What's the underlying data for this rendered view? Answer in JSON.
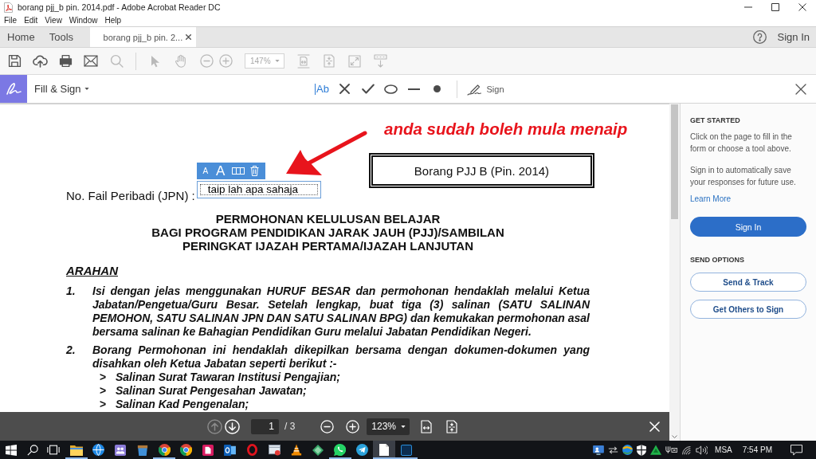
{
  "window": {
    "title": "borang pjj_b pin. 2014.pdf - Adobe Acrobat Reader DC"
  },
  "menu": [
    "File",
    "Edit",
    "View",
    "Window",
    "Help"
  ],
  "tabs": [
    {
      "label": "Home",
      "selected": false,
      "closable": false
    },
    {
      "label": "Tools",
      "selected": false,
      "closable": false
    },
    {
      "label": "borang pjj_b pin. 2...",
      "selected": true,
      "closable": true
    }
  ],
  "account": {
    "sign_in": "Sign In"
  },
  "toolbar": {
    "file_tools": [
      {
        "kind": "save",
        "disabled": false
      },
      {
        "kind": "upload",
        "disabled": false
      },
      {
        "kind": "print",
        "disabled": false
      },
      {
        "kind": "mail",
        "disabled": false
      },
      {
        "kind": "search",
        "disabled": true
      }
    ],
    "view_tools": [
      {
        "kind": "select",
        "disabled": true
      },
      {
        "kind": "hand",
        "disabled": true
      },
      {
        "kind": "zoom-out",
        "disabled": true
      },
      {
        "kind": "zoom-in",
        "disabled": true
      }
    ],
    "zoom": {
      "value": "147%",
      "disabled": true
    },
    "page_tools": [
      {
        "kind": "page-width",
        "disabled": true
      },
      {
        "kind": "fit-page",
        "disabled": true
      },
      {
        "kind": "full-screen",
        "disabled": true
      },
      {
        "kind": "read-mode",
        "disabled": true
      }
    ]
  },
  "fill_sign": {
    "title": "Fill & Sign",
    "tools": [
      {
        "kind": "text",
        "label": "Ab"
      },
      {
        "kind": "cross"
      },
      {
        "kind": "check"
      },
      {
        "kind": "ellipse"
      },
      {
        "kind": "line"
      },
      {
        "kind": "dot"
      }
    ],
    "sign": "Sign"
  },
  "document": {
    "annotation": "anda sudah boleh mula menaip",
    "form_code": "Borang PJJ B (Pin. 2014)",
    "file_label": "No. Fail Peribadi (JPN) :",
    "text_field": {
      "value": "taip lah apa sahaja",
      "toolbar": [
        {
          "kind": "smaller",
          "label": "A"
        },
        {
          "kind": "larger",
          "label": "A"
        },
        {
          "kind": "spacing"
        },
        {
          "kind": "delete"
        }
      ]
    },
    "headings": [
      "PERMOHONAN KELULUSAN BELAJAR",
      "BAGI PROGRAM PENDIDIKAN JARAK JAUH (PJJ)/SAMBILAN",
      "PERINGKAT IJAZAH PERTAMA/IJAZAH LANJUTAN"
    ],
    "section_title": "ARAHAN",
    "instructions": [
      {
        "number": "1.",
        "text": "Isi dengan jelas menggunakan HURUF BESAR dan permohonan hendaklah melalui Ketua Jabatan/Pengetua/Guru Besar. Setelah lengkap, buat tiga (3) salinan (SATU SALINAN PEMOHON, SATU SALINAN JPN DAN SATU SALINAN BPG) dan kemukakan permohonan asal bersama salinan ke Bahagian Pendidikan Guru melalui Jabatan Pendidikan Negeri."
      },
      {
        "number": "2.",
        "text": "Borang Permohonan ini hendaklah dikepilkan bersama dengan dokumen-dokumen yang disahkan oleh Ketua Jabatan seperti berikut :-",
        "items": [
          {
            "marker": ">",
            "text": "Salinan Surat Tawaran Institusi Pengajian;"
          },
          {
            "marker": ">",
            "text": "Salinan Surat Pengesahan Jawatan;"
          },
          {
            "marker": ">",
            "text": "Salinan Kad Pengenalan;"
          }
        ]
      }
    ]
  },
  "page_nav": {
    "previous": {
      "disabled": true
    },
    "next": {
      "disabled": false
    },
    "page": "1",
    "total": "/ 3",
    "zoom": "123%"
  },
  "side_panel": {
    "get_started": {
      "title": "GET STARTED",
      "paragraphs": [
        "Click on the page to fill in the form or choose a tool above.",
        "Sign in to automatically save your responses for future use."
      ],
      "link": "Learn More",
      "button": "Sign In"
    },
    "send_options": {
      "title": "SEND OPTIONS",
      "buttons": [
        "Send & Track",
        "Get Others to Sign"
      ]
    }
  },
  "taskbar": {
    "apps": [
      {
        "kind": "folder",
        "running": true,
        "active": false
      },
      {
        "kind": "globe",
        "running": false,
        "active": false
      },
      {
        "kind": "tile-people",
        "running": false,
        "active": false
      },
      {
        "kind": "cup",
        "running": false,
        "active": false
      },
      {
        "kind": "segmented-circle",
        "running": true,
        "active": false
      },
      {
        "kind": "segmented-circle",
        "running": false,
        "active": false
      },
      {
        "kind": "tile-figure",
        "running": false,
        "active": false
      },
      {
        "kind": "envelope-tile",
        "running": false,
        "active": false
      },
      {
        "kind": "ring",
        "running": false,
        "active": false
      },
      {
        "kind": "window",
        "running": false,
        "active": false
      },
      {
        "kind": "cone",
        "running": false,
        "active": false
      },
      {
        "kind": "diamond",
        "running": false,
        "active": false
      },
      {
        "kind": "chat-bubble",
        "running": true,
        "active": false
      },
      {
        "kind": "paper-plane",
        "running": false,
        "active": false
      },
      {
        "kind": "document",
        "running": true,
        "active": true
      },
      {
        "kind": "tile-dark",
        "running": true,
        "active": false
      }
    ],
    "language": "MSA",
    "time": "7:54 PM"
  }
}
